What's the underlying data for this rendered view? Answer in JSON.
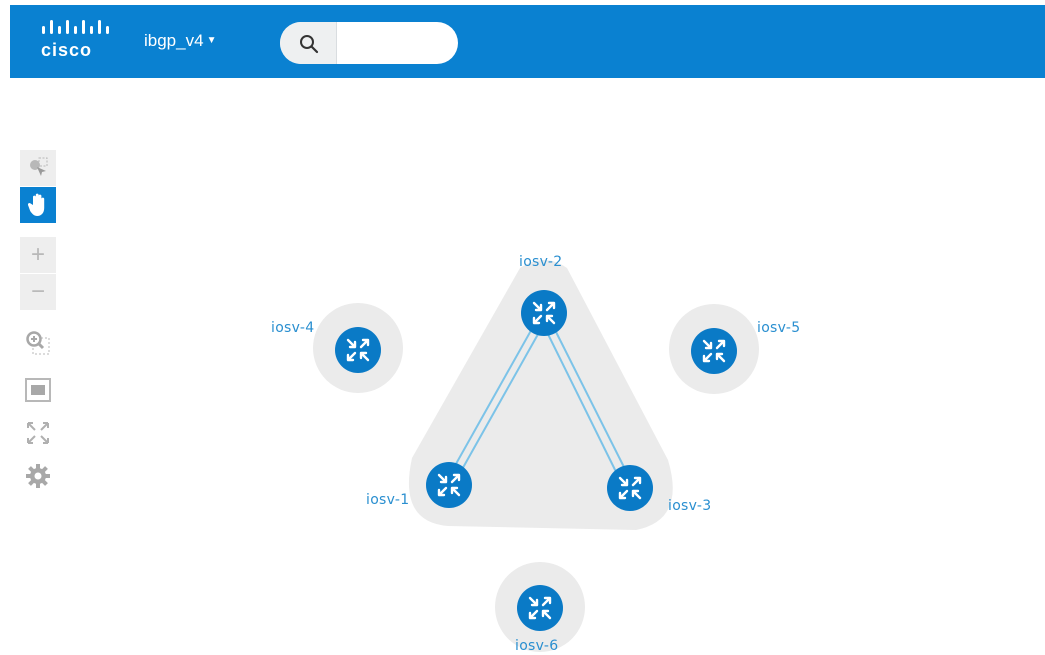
{
  "header": {
    "brand": "cisco",
    "project_name": "ibgp_v4",
    "search_placeholder": "",
    "color": "#0a81d1"
  },
  "toolbar": {
    "items": [
      {
        "name": "select-tool",
        "icon": "pointer-select-icon",
        "active": false
      },
      {
        "name": "pan-tool",
        "icon": "hand-icon",
        "active": true
      },
      {
        "name": "zoom-in",
        "icon": "plus-icon",
        "active": false
      },
      {
        "name": "zoom-out",
        "icon": "minus-icon",
        "active": false
      },
      {
        "name": "zoom-selection",
        "icon": "zoom-region-icon",
        "active": false
      },
      {
        "name": "fit-to-screen",
        "icon": "fit-screen-icon",
        "active": false
      },
      {
        "name": "fullscreen",
        "icon": "expand-arrows-icon",
        "active": false
      },
      {
        "name": "settings",
        "icon": "gear-icon",
        "active": false
      }
    ]
  },
  "topology": {
    "nodes": [
      {
        "id": "iosv-1",
        "label": "iosv-1",
        "icon": "router-icon"
      },
      {
        "id": "iosv-2",
        "label": "iosv-2",
        "icon": "router-icon"
      },
      {
        "id": "iosv-3",
        "label": "iosv-3",
        "icon": "router-icon"
      },
      {
        "id": "iosv-4",
        "label": "iosv-4",
        "icon": "router-icon"
      },
      {
        "id": "iosv-5",
        "label": "iosv-5",
        "icon": "router-icon"
      },
      {
        "id": "iosv-6",
        "label": "iosv-6",
        "icon": "router-icon"
      }
    ],
    "links": [
      {
        "from": "iosv-1",
        "to": "iosv-2",
        "count": 2
      },
      {
        "from": "iosv-2",
        "to": "iosv-3",
        "count": 2
      }
    ],
    "groups": [
      {
        "members": [
          "iosv-1",
          "iosv-2",
          "iosv-3"
        ]
      }
    ],
    "colors": {
      "node": "#0a7ac6",
      "halo": "#ebebeb",
      "link": "#7cc3e8",
      "label": "#2a8fd0"
    }
  }
}
